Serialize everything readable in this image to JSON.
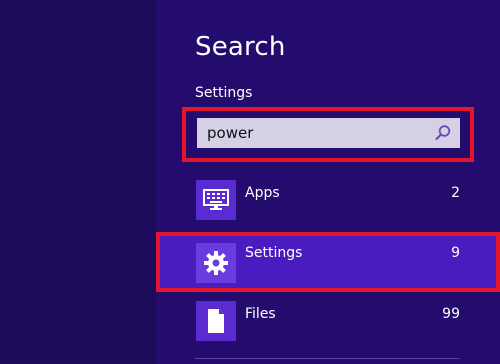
{
  "charm": {
    "title": "Search",
    "scope": "Settings",
    "search": {
      "value": "power",
      "icon": "search-icon"
    },
    "results": [
      {
        "label": "Apps",
        "count": "2",
        "icon": "apps-icon",
        "selected": false
      },
      {
        "label": "Settings",
        "count": "9",
        "icon": "gear-icon",
        "selected": true
      },
      {
        "label": "Files",
        "count": "99",
        "icon": "file-icon",
        "selected": false
      }
    ]
  },
  "colors": {
    "background": "#1e0a5e",
    "accent": "#4a1bbf",
    "highlight": "#e3162c"
  }
}
